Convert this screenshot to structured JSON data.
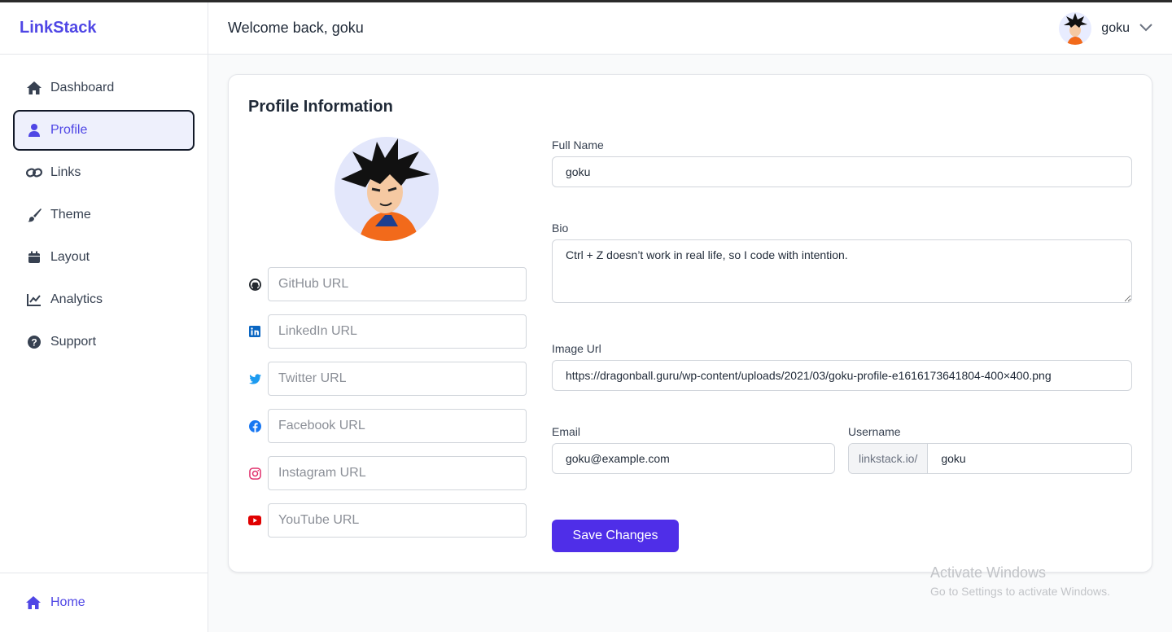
{
  "app": {
    "brand": "LinkStack",
    "accent": "#4f46e5"
  },
  "header": {
    "welcome": "Welcome back, goku",
    "username": "goku"
  },
  "sidebar": {
    "items": [
      {
        "label": "Dashboard",
        "icon": "home-icon"
      },
      {
        "label": "Profile",
        "icon": "user-icon",
        "active": true
      },
      {
        "label": "Links",
        "icon": "link-icon"
      },
      {
        "label": "Theme",
        "icon": "brush-icon"
      },
      {
        "label": "Layout",
        "icon": "layout-icon"
      },
      {
        "label": "Analytics",
        "icon": "chart-icon"
      },
      {
        "label": "Support",
        "icon": "question-icon"
      }
    ],
    "bottom": {
      "label": "Home",
      "icon": "home-icon"
    }
  },
  "profile": {
    "title": "Profile Information",
    "social": [
      {
        "placeholder": "GitHub URL",
        "icon": "github-icon",
        "color": "#24292f"
      },
      {
        "placeholder": "LinkedIn URL",
        "icon": "linkedin-icon",
        "color": "#0a66c2"
      },
      {
        "placeholder": "Twitter URL",
        "icon": "twitter-icon",
        "color": "#1d9bf0"
      },
      {
        "placeholder": "Facebook URL",
        "icon": "facebook-icon",
        "color": "#1877f2"
      },
      {
        "placeholder": "Instagram URL",
        "icon": "instagram-icon",
        "color": "#e1306c"
      },
      {
        "placeholder": "YouTube URL",
        "icon": "youtube-icon",
        "color": "#e00000"
      }
    ],
    "full_name": {
      "label": "Full Name",
      "value": "goku"
    },
    "bio": {
      "label": "Bio",
      "value": "Ctrl + Z doesn’t work in real life, so I code with intention."
    },
    "image_url": {
      "label": "Image Url",
      "value": "https://dragonball.guru/wp-content/uploads/2021/03/goku-profile-e1616173641804-400×400.png"
    },
    "email": {
      "label": "Email",
      "value": "goku@example.com"
    },
    "username": {
      "label": "Username",
      "prefix": "linkstack.io/",
      "value": "goku"
    },
    "save_label": "Save Changes"
  },
  "watermark": {
    "title": "Activate Windows",
    "subtitle": "Go to Settings to activate Windows."
  }
}
